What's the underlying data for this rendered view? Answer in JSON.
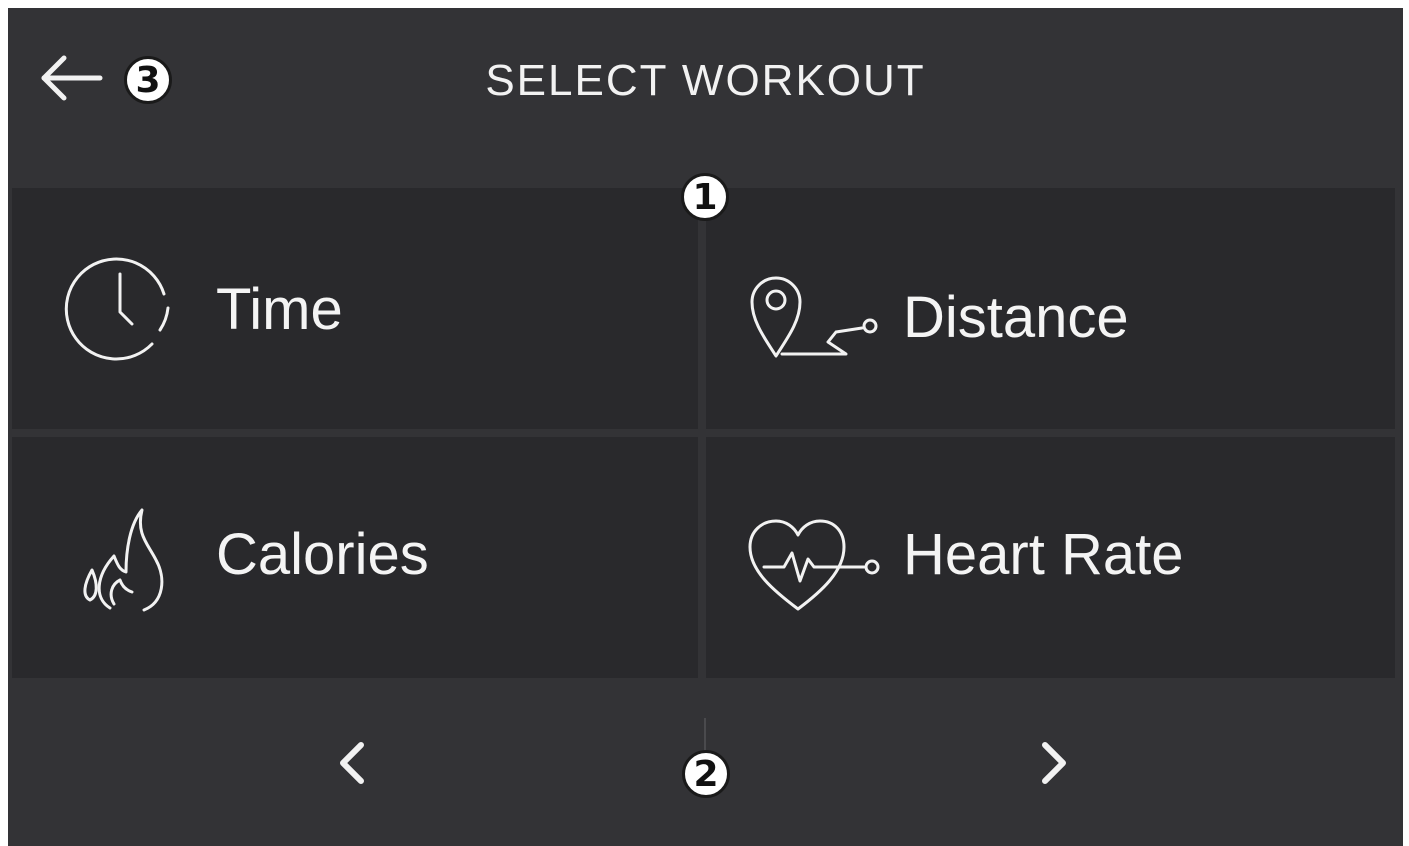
{
  "header": {
    "title": "SELECT WORKOUT",
    "back_icon": "arrow-left-icon"
  },
  "callouts": {
    "first": "1",
    "second": "2",
    "third": "3"
  },
  "workouts": [
    {
      "label": "Time",
      "icon": "clock-icon"
    },
    {
      "label": "Distance",
      "icon": "location-route-icon"
    },
    {
      "label": "Calories",
      "icon": "flame-drop-icon"
    },
    {
      "label": "Heart Rate",
      "icon": "heart-pulse-icon"
    }
  ],
  "pager": {
    "prev_icon": "chevron-left-icon",
    "next_icon": "chevron-right-icon"
  },
  "colors": {
    "screen_background": "#333336",
    "tile_background": "#29292c",
    "text": "#f4f4f4"
  }
}
